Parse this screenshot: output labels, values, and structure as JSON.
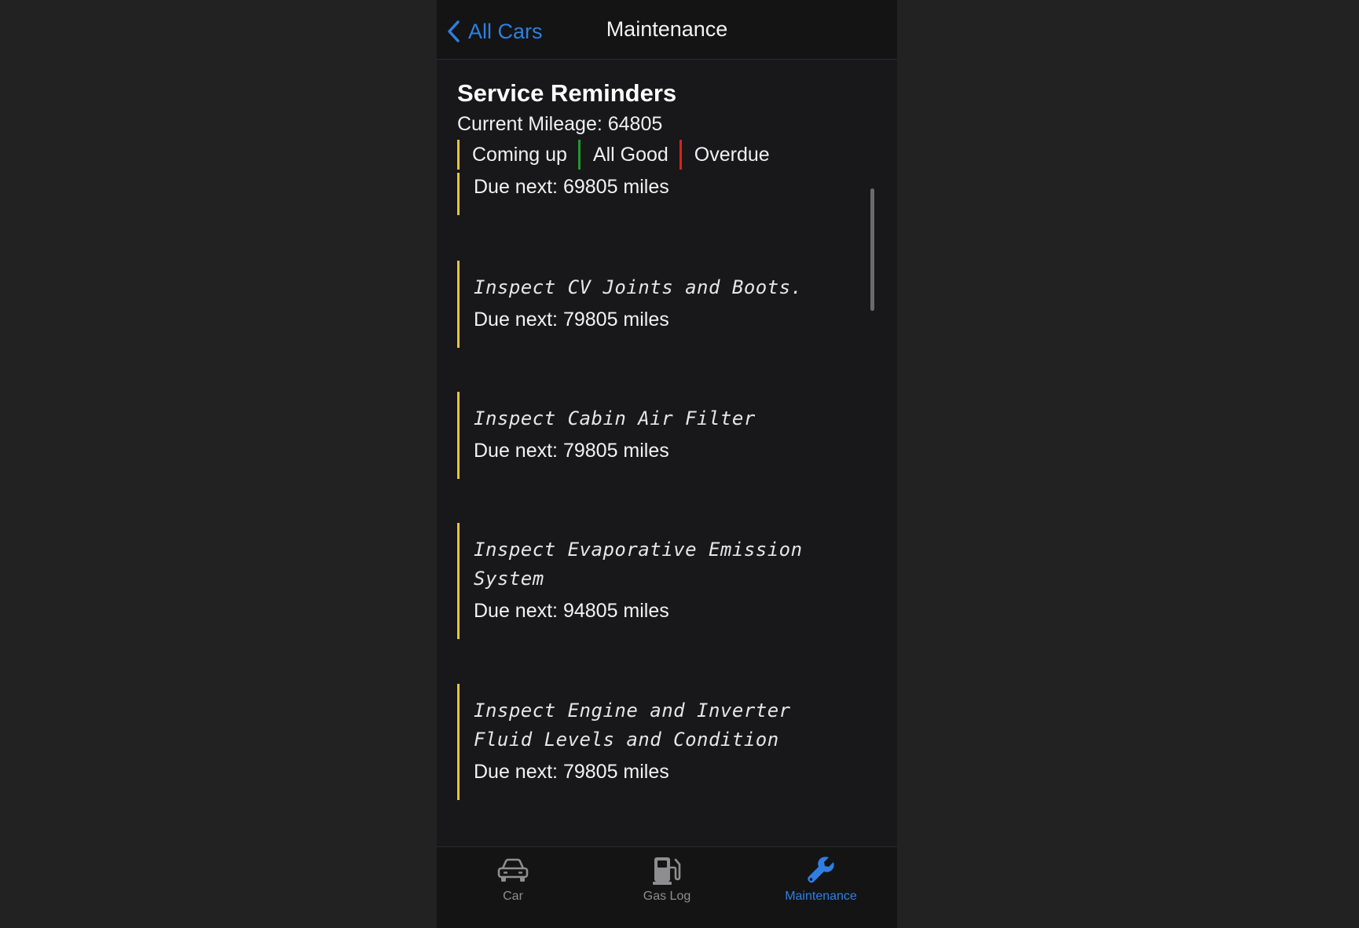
{
  "nav": {
    "back_label": "All Cars",
    "title": "Maintenance"
  },
  "header": {
    "title": "Service Reminders",
    "mileage": "Current Mileage: 64805",
    "legend": [
      {
        "label": "Coming up",
        "color": "#e8c53a"
      },
      {
        "label": "All Good",
        "color": "#1f9a2e"
      },
      {
        "label": "Overdue",
        "color": "#d8231c"
      }
    ]
  },
  "reminders": [
    {
      "title": "",
      "due": "Due next: 69805 miles",
      "status": "coming-up"
    },
    {
      "title": "Inspect CV Joints and Boots.",
      "due": "Due next: 79805 miles",
      "status": "coming-up"
    },
    {
      "title": "Inspect Cabin Air Filter",
      "due": "Due next: 79805 miles",
      "status": "coming-up"
    },
    {
      "title": "Inspect Evaporative Emission System",
      "due": "Due next: 94805 miles",
      "status": "coming-up"
    },
    {
      "title": "Inspect Engine and Inverter Fluid Levels and Condition",
      "due": "Due next: 79805 miles",
      "status": "coming-up"
    }
  ],
  "tabs": [
    {
      "label": "Car",
      "icon": "car-icon",
      "active": false
    },
    {
      "label": "Gas Log",
      "icon": "fuel-pump-icon",
      "active": false
    },
    {
      "label": "Maintenance",
      "icon": "wrench-icon",
      "active": true
    }
  ],
  "colors": {
    "accent": "#2f7fe0",
    "coming_up": "#e8c53a",
    "all_good": "#1f9a2e",
    "overdue": "#d8231c"
  }
}
